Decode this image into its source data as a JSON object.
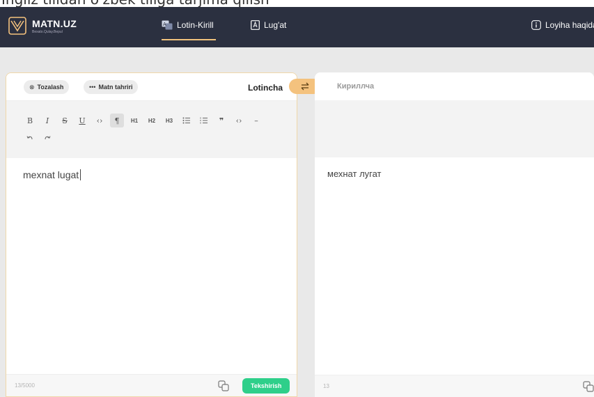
{
  "top_clipped_text": "Ingliz tilidan o'zbek tiliga tarjima qilish",
  "brand": {
    "title": "MATN.UZ",
    "tagline": "Bexato.Qulay.Bepul"
  },
  "nav": {
    "items": [
      {
        "label": "Lotin-Kirill",
        "icon": "translate-icon",
        "active": true
      },
      {
        "label": "Lug'at",
        "icon": "dictionary-icon",
        "active": false
      }
    ],
    "about": {
      "label": "Loyiha haqida",
      "icon": "info-icon"
    }
  },
  "left_panel": {
    "clear_label": "Tozalash",
    "edit_label": "Matn tahriri",
    "language": "Lotincha",
    "toolbar_row1": [
      "B",
      "I",
      "S",
      "U",
      "<>",
      "¶",
      "H1",
      "H2",
      "H3",
      "bullet-list",
      "ordered-list",
      "quote",
      "code-block",
      "hr"
    ],
    "input_text": "mexnat lugat",
    "counter": "13/5000",
    "check_label": "Tekshirish"
  },
  "right_panel": {
    "language": "Кириллча",
    "output_text": "мехнат лугат",
    "counter": "13"
  },
  "colors": {
    "navbar": "#2b3040",
    "accent": "#f4c27e",
    "check_button": "#2ecf8a",
    "background": "#e9e9e9"
  }
}
